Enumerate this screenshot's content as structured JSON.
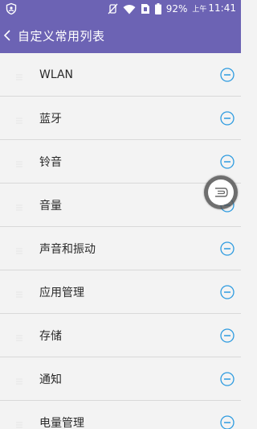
{
  "status_bar": {
    "battery": "92%",
    "ampm": "上午",
    "time": "11:41",
    "icons": [
      "shield-icon",
      "silent-icon",
      "wifi-icon",
      "sim-icon",
      "battery-icon"
    ]
  },
  "header": {
    "title": "自定义常用列表",
    "back_icon": "chevron-left-icon"
  },
  "list": {
    "items": [
      {
        "label": "WLAN"
      },
      {
        "label": "蓝牙"
      },
      {
        "label": "铃音"
      },
      {
        "label": "音量"
      },
      {
        "label": "声音和振动"
      },
      {
        "label": "应用管理"
      },
      {
        "label": "存储"
      },
      {
        "label": "通知"
      },
      {
        "label": "电量管理"
      }
    ],
    "remove_icon": "minus-circle-icon"
  },
  "floating_button": {
    "icon": "assistive-touch-icon"
  },
  "colors": {
    "header_bg": "#6c63b4",
    "list_bg": "#f3f3f3",
    "accent": "#2d9be0",
    "divider": "#d9d9d9"
  }
}
